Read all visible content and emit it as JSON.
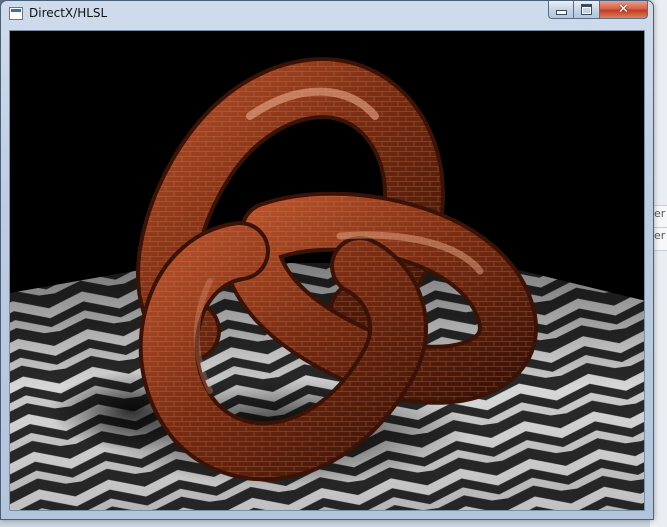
{
  "window": {
    "title": "DirectX/HLSL",
    "icon": "app-window-icon",
    "buttons": {
      "minimize_icon": "minimize-icon",
      "maximize_icon": "maximize-icon",
      "close_icon": "close-icon"
    }
  },
  "background_fragments": [
    "er",
    "er"
  ],
  "scene": {
    "description_icon": "trefoil-knot-render",
    "knot_color": "#7a2d12",
    "floor_light": "#e6e6e6",
    "floor_dark": "#2a2a2a",
    "sky_color": "#000000"
  }
}
